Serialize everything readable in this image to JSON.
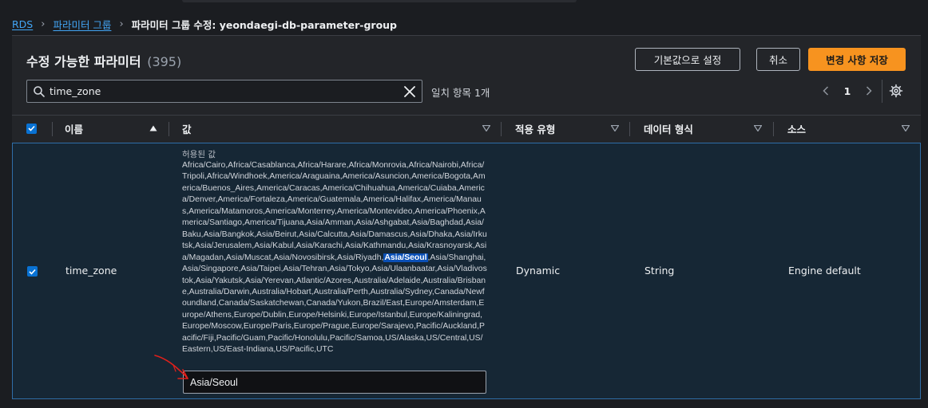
{
  "breadcrumb": {
    "items": [
      "RDS",
      "파라미터 그룹"
    ],
    "current": "파라미터 그룹 수정: yeondaegi-db-parameter-group"
  },
  "header": {
    "title": "수정 가능한 파라미터",
    "count": "(395)",
    "reset_label": "기본값으로 설정",
    "cancel_label": "취소",
    "save_label": "변경 사항 저장"
  },
  "search": {
    "value": "time_zone",
    "match_text": "일치 항목 1개"
  },
  "pagination": {
    "page": "1"
  },
  "table": {
    "headers": [
      "이름",
      "값",
      "적용 유형",
      "데이터 형식",
      "소스"
    ],
    "row": {
      "name": "time_zone",
      "allowed_label": "허용된 값",
      "allowed_before": "Africa/Cairo,Africa/Casablanca,Africa/Harare,Africa/Monrovia,Africa/Nairobi,Africa/Tripoli,Africa/Windhoek,America/Araguaina,America/Asuncion,America/Bogota,America/Buenos_Aires,America/Caracas,America/Chihuahua,America/Cuiaba,America/Denver,America/Fortaleza,America/Guatemala,America/Halifax,America/Manaus,America/Matamoros,America/Monterrey,America/Montevideo,America/Phoenix,America/Santiago,America/Tijuana,Asia/Amman,Asia/Ashgabat,Asia/Baghdad,Asia/Baku,Asia/Bangkok,Asia/Beirut,Asia/Calcutta,Asia/Damascus,Asia/Dhaka,Asia/Irkutsk,Asia/Jerusalem,Asia/Kabul,Asia/Karachi,Asia/Kathmandu,Asia/Krasnoyarsk,Asia/Magadan,Asia/Muscat,Asia/Novosibirsk,Asia/Riyadh,",
      "allowed_highlight": "Asia/Seoul",
      "allowed_after": ",Asia/Shanghai,Asia/Singapore,Asia/Taipei,Asia/Tehran,Asia/Tokyo,Asia/Ulaanbaatar,Asia/Vladivostok,Asia/Yakutsk,Asia/Yerevan,Atlantic/Azores,Australia/Adelaide,Australia/Brisbane,Australia/Darwin,Australia/Hobart,Australia/Perth,Australia/Sydney,Canada/Newfoundland,Canada/Saskatchewan,Canada/Yukon,Brazil/East,Europe/Amsterdam,Europe/Athens,Europe/Dublin,Europe/Helsinki,Europe/Istanbul,Europe/Kaliningrad,Europe/Moscow,Europe/Paris,Europe/Prague,Europe/Sarajevo,Pacific/Auckland,Pacific/Fiji,Pacific/Guam,Pacific/Honolulu,Pacific/Samoa,US/Alaska,US/Central,US/Eastern,US/East-Indiana,US/Pacific,UTC",
      "value": "Asia/Seoul",
      "apply_type": "Dynamic",
      "data_type": "String",
      "source": "Engine default"
    }
  },
  "colors": {
    "accent": "#f7931f",
    "link": "#42a5f5",
    "checkbox": "#0972d3",
    "annotation": "#e0201b"
  },
  "icons": [
    "chevron-right-icon",
    "search-icon",
    "clear-icon",
    "chevron-left-icon",
    "gear-icon",
    "sort-ascending-icon",
    "sort-descending-icon",
    "checkbox-checked-icon",
    "annotation-arrow-icon"
  ]
}
